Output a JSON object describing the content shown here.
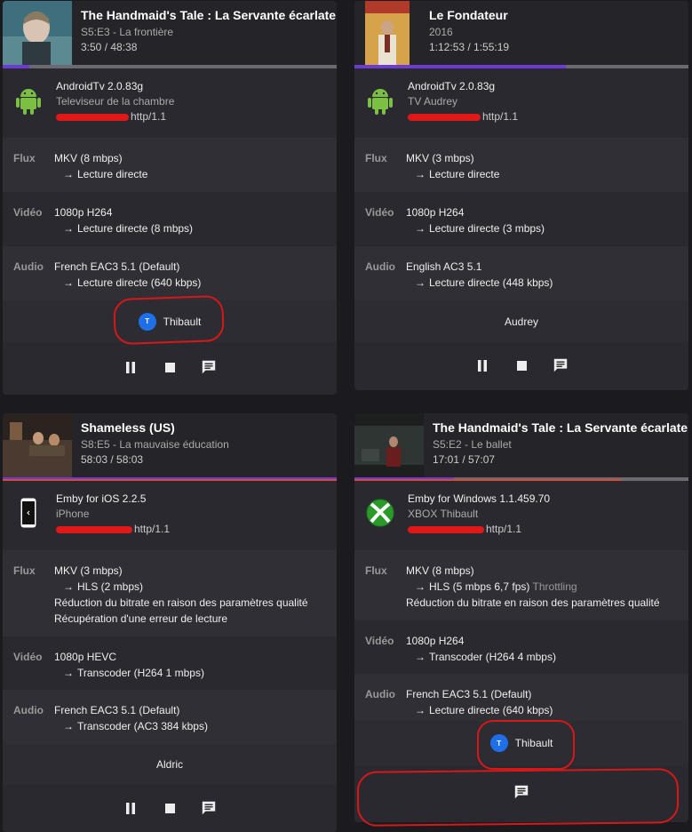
{
  "cards": [
    {
      "title": "The Handmaid's Tale : La Servante écarlate",
      "sub": "S5:E3 - La frontière",
      "time": "3:50 / 48:38",
      "device_name": "AndroidTv 2.0.83g",
      "device_model": "Televiseur de la chambre",
      "device_addr": "http/1.1",
      "flux_label": "Flux",
      "flux": [
        "MKV (8 mbps)",
        "Lecture directe"
      ],
      "video_label": "Vidéo",
      "video": [
        "1080p H264",
        "Lecture directe (8 mbps)"
      ],
      "audio_label": "Audio",
      "audio": [
        "French EAC3 5.1 (Default)",
        "Lecture directe (640 kbps)"
      ],
      "user": "Thibault",
      "user_initial": "T",
      "progress": 0.079
    },
    {
      "title": "Le Fondateur",
      "sub": "2016",
      "time": "1:12:53 / 1:55:19",
      "device_name": "AndroidTv 2.0.83g",
      "device_model": "TV Audrey",
      "device_addr": "http/1.1",
      "flux_label": "Flux",
      "flux": [
        "MKV (3 mbps)",
        "Lecture directe"
      ],
      "video_label": "Vidéo",
      "video": [
        "1080p H264",
        "Lecture directe (3 mbps)"
      ],
      "audio_label": "Audio",
      "audio": [
        "English AC3 5.1",
        "Lecture directe (448 kbps)"
      ],
      "user": "Audrey",
      "progress": 0.632
    },
    {
      "title": "Shameless (US)",
      "sub": "S8:E5 - La mauvaise éducation",
      "time": "58:03 / 58:03",
      "device_name": "Emby for iOS 2.2.5",
      "device_model": "iPhone",
      "device_addr": "http/1.1",
      "flux_label": "Flux",
      "flux": [
        "MKV (3 mbps)",
        "HLS (2 mbps)",
        "Réduction du bitrate en raison des paramètres qualité",
        "Récupération d'une erreur de lecture"
      ],
      "video_label": "Vidéo",
      "video": [
        "1080p HEVC",
        "Transcoder (H264 1 mbps)"
      ],
      "audio_label": "Audio",
      "audio": [
        "French EAC3 5.1 (Default)",
        "Transcoder (AC3 384 kbps)"
      ],
      "user": "Aldric",
      "progress": 1.0
    },
    {
      "title": "The Handmaid's Tale : La Servante écarlate",
      "sub": "S5:E2 - Le ballet",
      "time": "17:01 / 57:07",
      "device_name": "Emby for Windows 1.1.459.70",
      "device_model": "XBOX Thibault",
      "device_addr": "http/1.1",
      "flux_label": "Flux",
      "flux": [
        "MKV (8 mbps)",
        "HLS (5 mbps 6,7 fps)",
        "Throttling",
        "Réduction du bitrate en raison des paramètres qualité"
      ],
      "video_label": "Vidéo",
      "video": [
        "1080p H264",
        "Transcoder (H264 4 mbps)"
      ],
      "audio_label": "Audio",
      "audio": [
        "French EAC3 5.1 (Default)",
        "Lecture directe (640 kbps)"
      ],
      "user": "Thibault",
      "user_initial": "T",
      "progress": 0.298
    }
  ],
  "arrow": "→"
}
